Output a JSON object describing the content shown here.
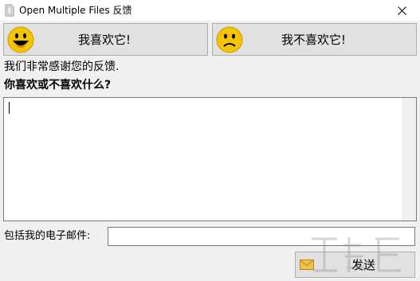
{
  "window": {
    "title": "Open Multiple Files 反馈"
  },
  "buttons": {
    "like_label": "我喜欢它!",
    "dislike_label": "我不喜欢它!",
    "send_label": "发送"
  },
  "text": {
    "thanks": "我们非常感谢您的反馈.",
    "question": "你喜欢或不喜欢什么?"
  },
  "feedback": {
    "value": ""
  },
  "email": {
    "label": "包括我的电子邮件:",
    "value": ""
  },
  "colors": {
    "smiley": "#f5c400",
    "window_bg": "#f0f0f0",
    "button_bg": "#e1e1e1"
  }
}
